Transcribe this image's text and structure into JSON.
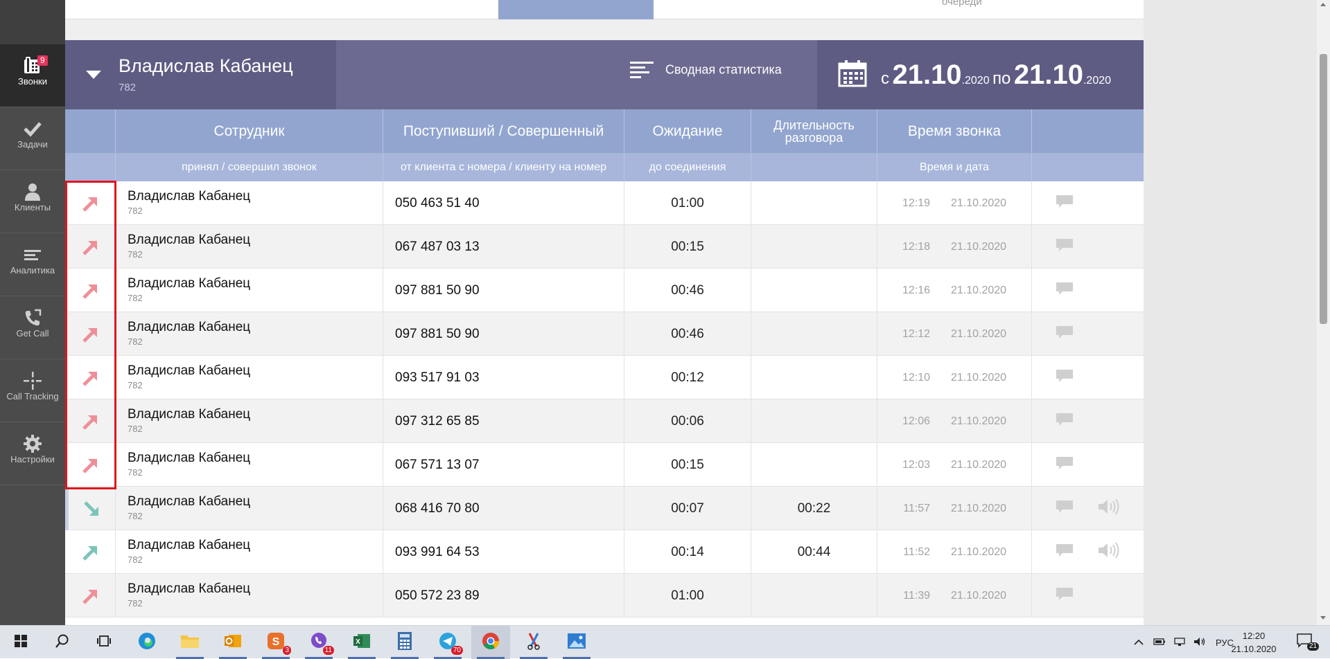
{
  "sidebar": {
    "items": [
      {
        "label": "Звонки",
        "icon": "phone-icon",
        "badge": "9",
        "active": true
      },
      {
        "label": "Задачи",
        "icon": "checkmark-icon"
      },
      {
        "label": "Клиенты",
        "icon": "person-icon"
      },
      {
        "label": "Аналитика",
        "icon": "bars-icon"
      },
      {
        "label": "Get Call",
        "icon": "handset-icon"
      },
      {
        "label": "Call Tracking",
        "icon": "crosshair-icon"
      },
      {
        "label": "Настройки",
        "icon": "gear-icon"
      }
    ]
  },
  "topstrip": {
    "ghost_text": "очереди"
  },
  "header": {
    "user_name": "Владислав Кабанец",
    "user_ext": "782",
    "stats_label": "Сводная статистика",
    "date_from_prefix": "с",
    "date_from": "21.10",
    "date_from_year": ".2020",
    "date_to_prefix": "по",
    "date_to": "21.10",
    "date_to_year": ".2020"
  },
  "table": {
    "headers": {
      "employee": "Сотрудник",
      "number": "Поступивший / Совершенный",
      "wait": "Ожидание",
      "duration_line1": "Длительность",
      "duration_line2": "разговора",
      "time": "Время звонка"
    },
    "subheaders": {
      "employee": "принял / совершил звонок",
      "number": "от клиента с номера / клиенту на номер",
      "wait": "до соединения",
      "time": "Время и дата"
    },
    "rows": [
      {
        "dir": "outgoing-missed",
        "name": "Владислав Кабанец",
        "ext": "782",
        "phone": "050 463 51 40",
        "wait": "01:00",
        "duration": "",
        "time": "12:19",
        "date": "21.10.2020",
        "audio": false
      },
      {
        "dir": "outgoing-missed",
        "name": "Владислав Кабанец",
        "ext": "782",
        "phone": "067 487 03 13",
        "wait": "00:15",
        "duration": "",
        "time": "12:18",
        "date": "21.10.2020",
        "audio": false
      },
      {
        "dir": "outgoing-missed",
        "name": "Владислав Кабанец",
        "ext": "782",
        "phone": "097 881 50 90",
        "wait": "00:46",
        "duration": "",
        "time": "12:16",
        "date": "21.10.2020",
        "audio": false
      },
      {
        "dir": "outgoing-missed",
        "name": "Владислав Кабанец",
        "ext": "782",
        "phone": "097 881 50 90",
        "wait": "00:46",
        "duration": "",
        "time": "12:12",
        "date": "21.10.2020",
        "audio": false
      },
      {
        "dir": "outgoing-missed",
        "name": "Владислав Кабанец",
        "ext": "782",
        "phone": "093 517 91 03",
        "wait": "00:12",
        "duration": "",
        "time": "12:10",
        "date": "21.10.2020",
        "audio": false
      },
      {
        "dir": "outgoing-missed",
        "name": "Владислав Кабанец",
        "ext": "782",
        "phone": "097 312 65 85",
        "wait": "00:06",
        "duration": "",
        "time": "12:06",
        "date": "21.10.2020",
        "audio": false
      },
      {
        "dir": "outgoing-missed",
        "name": "Владислав Кабанец",
        "ext": "782",
        "phone": "067 571 13 07",
        "wait": "00:15",
        "duration": "",
        "time": "12:03",
        "date": "21.10.2020",
        "audio": false
      },
      {
        "dir": "incoming-answered",
        "name": "Владислав Кабанец",
        "ext": "782",
        "phone": "068 416 70 80",
        "wait": "00:07",
        "duration": "00:22",
        "time": "11:57",
        "date": "21.10.2020",
        "audio": true
      },
      {
        "dir": "outgoing-answered",
        "name": "Владислав Кабанец",
        "ext": "782",
        "phone": "093 991 64 53",
        "wait": "00:14",
        "duration": "00:44",
        "time": "11:52",
        "date": "21.10.2020",
        "audio": true
      },
      {
        "dir": "outgoing-missed",
        "name": "Владислав Кабанец",
        "ext": "782",
        "phone": "050 572 23 89",
        "wait": "01:00",
        "duration": "",
        "time": "11:39",
        "date": "21.10.2020",
        "audio": false
      }
    ]
  },
  "colors": {
    "missed_arrow": "#ee8f98",
    "answered_arrow": "#7cc4b8",
    "highlight_box": "#e0141e"
  },
  "taskbar": {
    "apps": [
      {
        "icon": "windows-start-icon"
      },
      {
        "icon": "search-icon"
      },
      {
        "icon": "task-view-icon"
      },
      {
        "icon": "edge-icon"
      },
      {
        "icon": "file-explorer-icon"
      },
      {
        "icon": "outlook-icon"
      },
      {
        "icon": "skype-icon",
        "badge": "3"
      },
      {
        "icon": "viber-icon",
        "badge": "11"
      },
      {
        "icon": "excel-icon"
      },
      {
        "icon": "calculator-icon"
      },
      {
        "icon": "telegram-icon",
        "badge": "70"
      },
      {
        "icon": "chrome-icon"
      },
      {
        "icon": "snipping-tool-icon"
      },
      {
        "icon": "photos-icon"
      }
    ],
    "lang": "РУС",
    "time": "12:20",
    "date": "21.10.2020",
    "notifications": "21"
  }
}
